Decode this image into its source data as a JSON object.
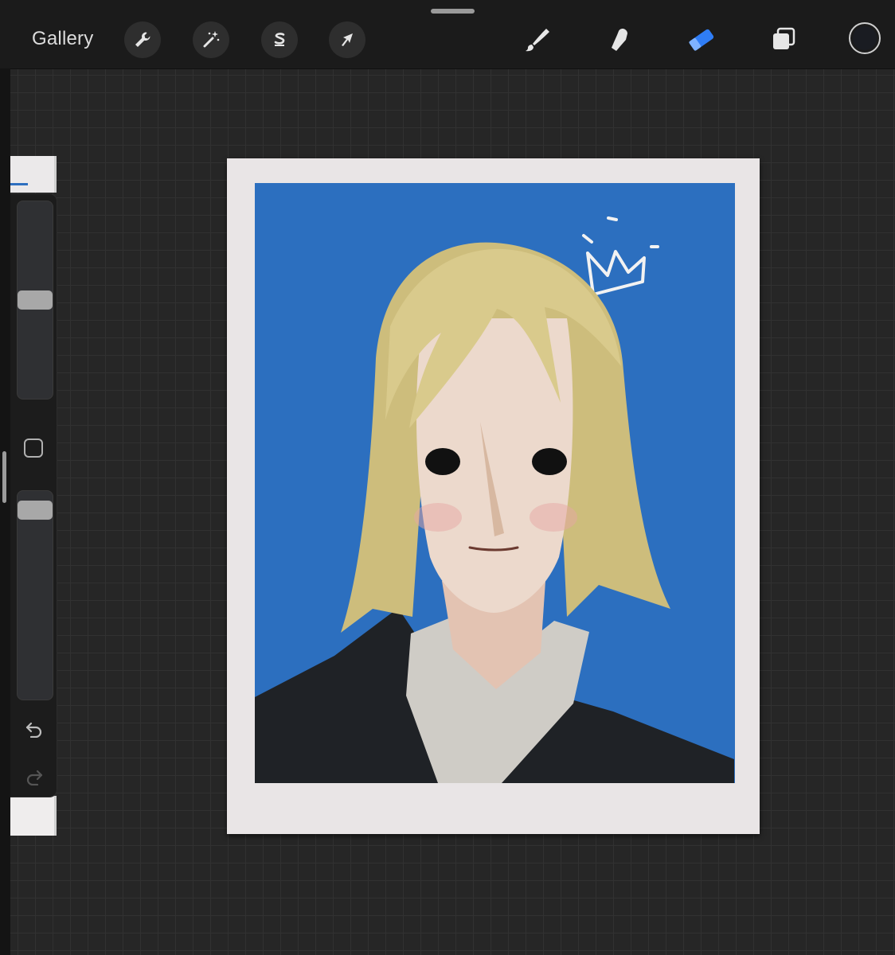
{
  "toolbar": {
    "gallery_label": "Gallery",
    "left_tools": [
      {
        "name": "actions",
        "icon": "wrench-icon"
      },
      {
        "name": "adjustments",
        "icon": "magic-wand-icon"
      },
      {
        "name": "selection",
        "icon": "selection-s-icon"
      },
      {
        "name": "transform",
        "icon": "arrow-cursor-icon"
      }
    ],
    "right_tools": [
      {
        "name": "brush",
        "icon": "brush-icon",
        "active": false
      },
      {
        "name": "smudge",
        "icon": "smudge-finger-icon",
        "active": false
      },
      {
        "name": "eraser",
        "icon": "eraser-icon",
        "active": true
      },
      {
        "name": "layers",
        "icon": "layers-icon",
        "active": false
      }
    ],
    "current_color": "#1a1c22",
    "active_color": "#2f7df6"
  },
  "sidebar": {
    "brush_size_level": 0.5,
    "brush_opacity_level": 0.95,
    "undo_icon": "undo-icon",
    "redo_icon": "redo-icon",
    "modify_icon": "square-icon"
  },
  "canvas": {
    "photo_background": "#2c6fbf",
    "frame_color": "#e9e5e6"
  }
}
